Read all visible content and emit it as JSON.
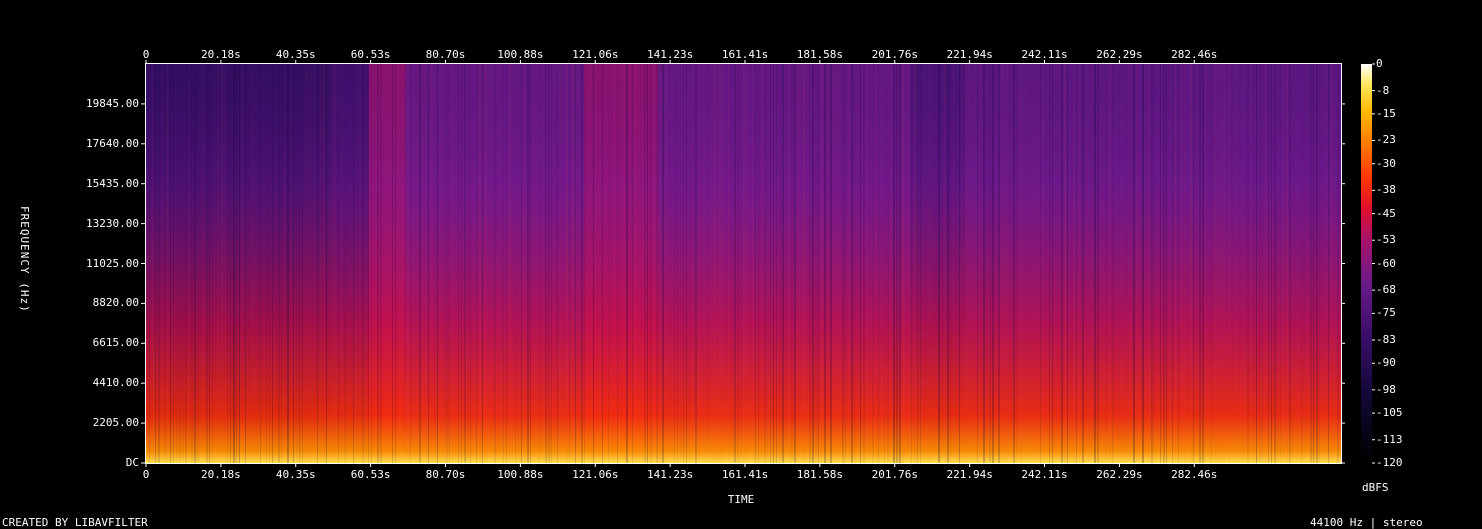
{
  "chart_data": {
    "type": "heatmap",
    "x_label": "TIME",
    "y_label": "FREQUENCY (Hz)",
    "colorbar_label": "dBFS",
    "x_ticks": [
      "0",
      "20.18s",
      "40.35s",
      "60.53s",
      "80.70s",
      "100.88s",
      "121.06s",
      "141.23s",
      "161.41s",
      "181.58s",
      "201.76s",
      "221.94s",
      "242.11s",
      "262.29s",
      "282.46s"
    ],
    "x_tick_values": [
      0,
      20.18,
      40.35,
      60.53,
      80.7,
      100.88,
      121.06,
      141.23,
      161.41,
      181.58,
      201.76,
      221.94,
      242.11,
      262.29,
      282.46
    ],
    "x_range": [
      0,
      322
    ],
    "y_ticks": [
      "DC",
      "2205.00",
      "4410.00",
      "6615.00",
      "8820.00",
      "11025.00",
      "13230.00",
      "15435.00",
      "17640.00",
      "19845.00"
    ],
    "y_tick_values": [
      0,
      2205,
      4410,
      6615,
      8820,
      11025,
      13230,
      15435,
      17640,
      19845
    ],
    "y_range": [
      0,
      22050
    ],
    "colorbar_ticks": [
      "0",
      "-8",
      "-15",
      "-23",
      "-30",
      "-38",
      "-45",
      "-53",
      "-60",
      "-68",
      "-75",
      "-83",
      "-90",
      "-98",
      "-105",
      "-113",
      "-120"
    ],
    "colorbar_range": [
      -120,
      0
    ],
    "segments": [
      {
        "t": [
          0,
          50
        ],
        "level": -85,
        "note": "sparse transients"
      },
      {
        "t": [
          50,
          60
        ],
        "level": -80
      },
      {
        "t": [
          60,
          70
        ],
        "level": -55
      },
      {
        "t": [
          70,
          118
        ],
        "level": -65
      },
      {
        "t": [
          118,
          138
        ],
        "level": -55
      },
      {
        "t": [
          138,
          206
        ],
        "level": -65
      },
      {
        "t": [
          206,
          221
        ],
        "level": -75
      },
      {
        "t": [
          221,
          322
        ],
        "level": -68
      }
    ]
  },
  "footer": {
    "credit": "CREATED BY LIBAVFILTER",
    "format": "44100 Hz | stereo"
  },
  "colors": {
    "background": "#000000",
    "axis": "#ffffff"
  }
}
